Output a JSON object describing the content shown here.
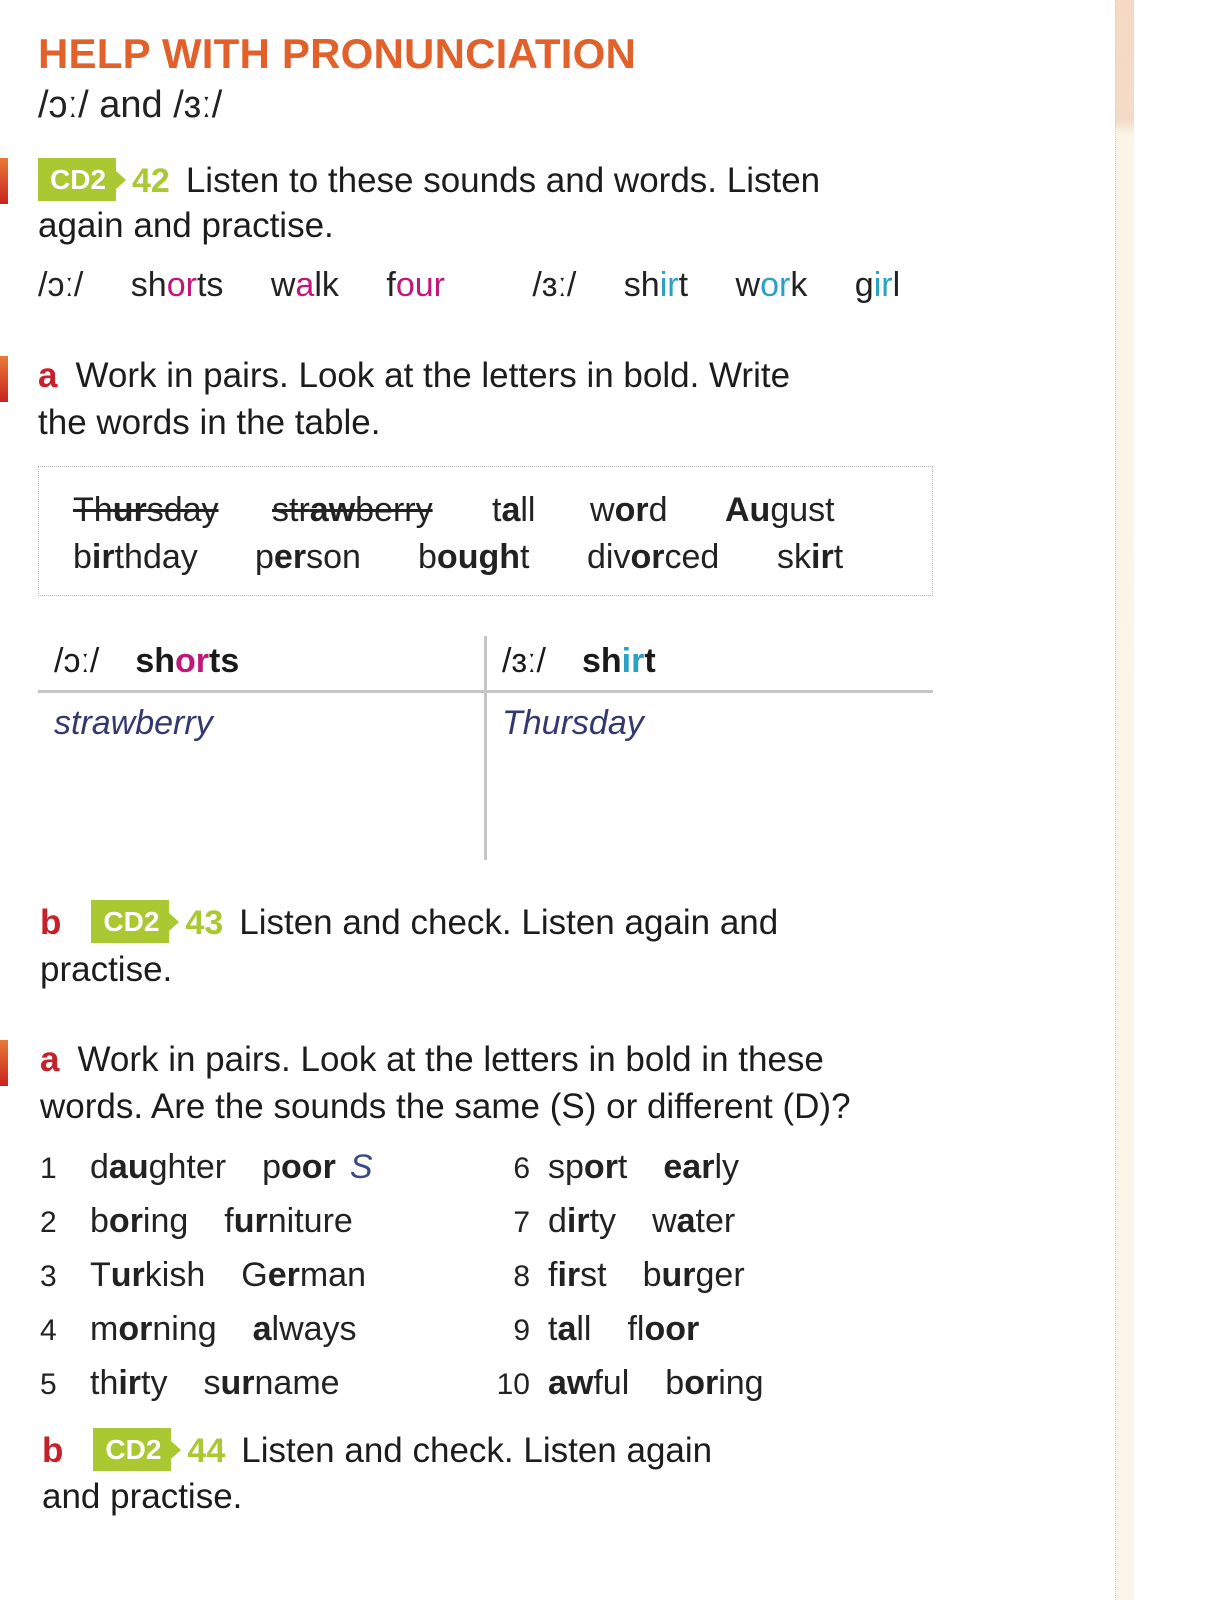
{
  "section": {
    "title": "HELP WITH PRONUNCIATION",
    "subtitle": "/ɔː/ and /ɜː/"
  },
  "exercise1": {
    "cd_label": "CD2",
    "track": "42",
    "instruction_line1": "Listen to these sounds and words. Listen",
    "instruction_line2": "again and practise.",
    "sound1": {
      "ipa": "/ɔː/",
      "words": [
        {
          "pre": "sh",
          "hl": "or",
          "post": "ts"
        },
        {
          "pre": "w",
          "hl": "a",
          "post": "lk"
        },
        {
          "pre": "f",
          "hl": "our",
          "post": ""
        }
      ]
    },
    "sound2": {
      "ipa": "/ɜː/",
      "words": [
        {
          "pre": "sh",
          "hl": "ir",
          "post": "t"
        },
        {
          "pre": "w",
          "hl": "or",
          "post": "k"
        },
        {
          "pre": "g",
          "hl": "ir",
          "post": "l"
        }
      ]
    },
    "colors": {
      "sound1": "#c0187a",
      "sound2": "#2aa0c6"
    }
  },
  "exercise2a": {
    "letter": "a",
    "instruction_line1": "Work in pairs. Look at the letters in bold. Write",
    "instruction_line2": "the words in the table.",
    "word_box": [
      {
        "pre": "Th",
        "hl": "ur",
        "post": "sday",
        "crossed": true
      },
      {
        "pre": "str",
        "hl": "aw",
        "post": "berry",
        "crossed": true
      },
      {
        "pre": "t",
        "hl": "a",
        "post": "ll",
        "crossed": false
      },
      {
        "pre": "w",
        "hl": "or",
        "post": "d",
        "crossed": false
      },
      {
        "pre": "",
        "hl": "Au",
        "post": "gust",
        "crossed": false
      },
      {
        "pre": "b",
        "hl": "ir",
        "post": "thday",
        "crossed": false
      },
      {
        "pre": "p",
        "hl": "er",
        "post": "son",
        "crossed": false
      },
      {
        "pre": "b",
        "hl": "ough",
        "post": "t",
        "crossed": false
      },
      {
        "pre": "div",
        "hl": "or",
        "post": "ced",
        "crossed": false
      },
      {
        "pre": "sk",
        "hl": "ir",
        "post": "t",
        "crossed": false
      }
    ],
    "table": {
      "col1": {
        "ipa": "/ɔː/",
        "word_pre": "sh",
        "word_hl": "or",
        "word_post": "ts",
        "example": "strawberry"
      },
      "col2": {
        "ipa": "/ɜː/",
        "word_pre": "sh",
        "word_hl": "ir",
        "word_post": "t",
        "example": "Thursday"
      }
    }
  },
  "exercise2b": {
    "letter": "b",
    "cd_label": "CD2",
    "track": "43",
    "instruction_line1": "Listen and check. Listen again and",
    "instruction_line2": "practise."
  },
  "exercise3a": {
    "letter": "a",
    "instruction_line1": "Work in pairs. Look at the letters in bold in these",
    "instruction_line2": "words. Are the sounds the same (S) or different (D)?",
    "items": [
      {
        "num": "1",
        "w1": {
          "pre": "d",
          "hl": "au",
          "post": "ghter"
        },
        "w2": {
          "pre": "p",
          "hl": "oor",
          "post": ""
        },
        "answer": "S"
      },
      {
        "num": "2",
        "w1": {
          "pre": "b",
          "hl": "or",
          "post": "ing"
        },
        "w2": {
          "pre": "f",
          "hl": "ur",
          "post": "niture"
        },
        "answer": ""
      },
      {
        "num": "3",
        "w1": {
          "pre": "T",
          "hl": "ur",
          "post": "kish"
        },
        "w2": {
          "pre": "G",
          "hl": "er",
          "post": "man"
        },
        "answer": ""
      },
      {
        "num": "4",
        "w1": {
          "pre": "m",
          "hl": "or",
          "post": "ning"
        },
        "w2": {
          "pre": "",
          "hl": "a",
          "post": "lways"
        },
        "answer": ""
      },
      {
        "num": "5",
        "w1": {
          "pre": "th",
          "hl": "ir",
          "post": "ty"
        },
        "w2": {
          "pre": "s",
          "hl": "ur",
          "post": "name"
        },
        "answer": ""
      },
      {
        "num": "6",
        "w1": {
          "pre": "sp",
          "hl": "or",
          "post": "t"
        },
        "w2": {
          "pre": "",
          "hl": "ear",
          "post": "ly"
        },
        "answer": ""
      },
      {
        "num": "7",
        "w1": {
          "pre": "d",
          "hl": "ir",
          "post": "ty"
        },
        "w2": {
          "pre": "w",
          "hl": "a",
          "post": "ter"
        },
        "answer": ""
      },
      {
        "num": "8",
        "w1": {
          "pre": "f",
          "hl": "ir",
          "post": "st"
        },
        "w2": {
          "pre": "b",
          "hl": "ur",
          "post": "ger"
        },
        "answer": ""
      },
      {
        "num": "9",
        "w1": {
          "pre": "t",
          "hl": "a",
          "post": "ll"
        },
        "w2": {
          "pre": "fl",
          "hl": "oor",
          "post": ""
        },
        "answer": ""
      },
      {
        "num": "10",
        "w1": {
          "pre": "",
          "hl": "aw",
          "post": "ful"
        },
        "w2": {
          "pre": "b",
          "hl": "or",
          "post": "ing"
        },
        "answer": ""
      }
    ]
  },
  "exercise3b": {
    "letter": "b",
    "cd_label": "CD2",
    "track": "44",
    "instruction_line1": "Listen and check. Listen again",
    "instruction_line2": "and practise."
  }
}
